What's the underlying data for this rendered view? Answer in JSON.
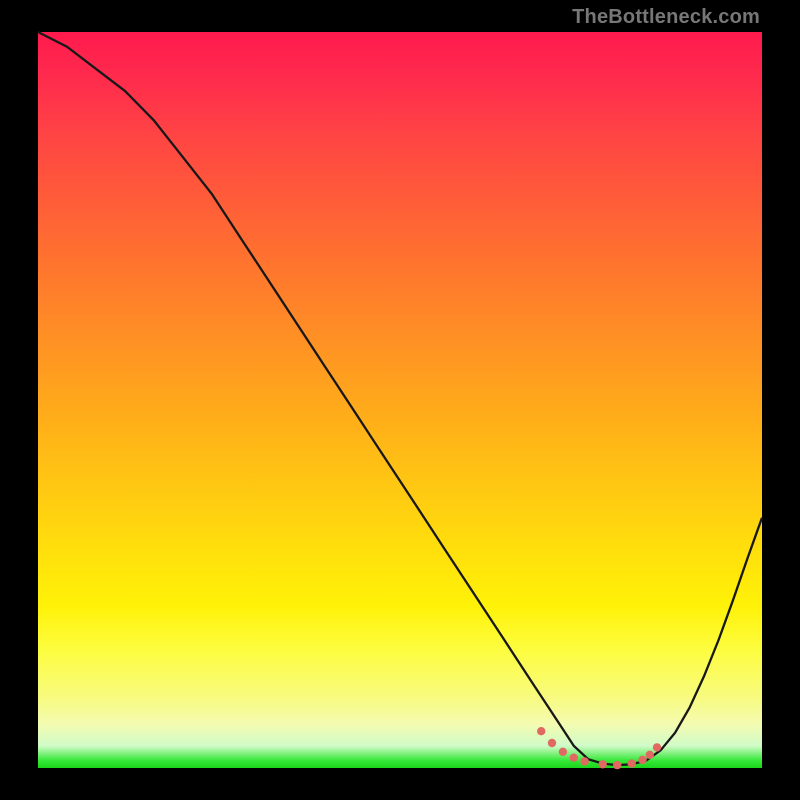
{
  "watermark": "TheBottleneck.com",
  "chart_data": {
    "type": "line",
    "title": "",
    "xlabel": "",
    "ylabel": "",
    "xlim": [
      0,
      100
    ],
    "ylim": [
      0,
      100
    ],
    "grid": false,
    "legend": false,
    "series": [
      {
        "name": "bottleneck-curve",
        "x": [
          0,
          4,
          8,
          12,
          16,
          20,
          24,
          28,
          32,
          36,
          40,
          44,
          48,
          52,
          56,
          60,
          64,
          68,
          70,
          72,
          74,
          76,
          78,
          80,
          82,
          84,
          86,
          88,
          90,
          92,
          94,
          96,
          98,
          100
        ],
        "values": [
          100,
          98,
          95,
          92,
          88,
          83,
          78,
          72,
          66,
          60,
          54,
          48,
          42,
          36,
          30,
          24,
          18,
          12,
          9,
          6,
          3,
          1.2,
          0.6,
          0.4,
          0.5,
          1.0,
          2.4,
          4.8,
          8.2,
          12.5,
          17.4,
          22.8,
          28.5,
          34
        ]
      }
    ],
    "markers": {
      "name": "highlight-dots",
      "x": [
        69.5,
        71,
        72.5,
        74,
        75.5,
        78,
        80,
        82,
        83.5,
        84.5,
        85.5
      ],
      "values": [
        5.0,
        3.4,
        2.2,
        1.4,
        0.9,
        0.5,
        0.4,
        0.6,
        1.1,
        1.8,
        2.8
      ]
    },
    "background_gradient": {
      "top": "#ff1a4d",
      "mid1": "#ff9c20",
      "mid2": "#fff208",
      "bottom": "#1ad41a"
    }
  }
}
